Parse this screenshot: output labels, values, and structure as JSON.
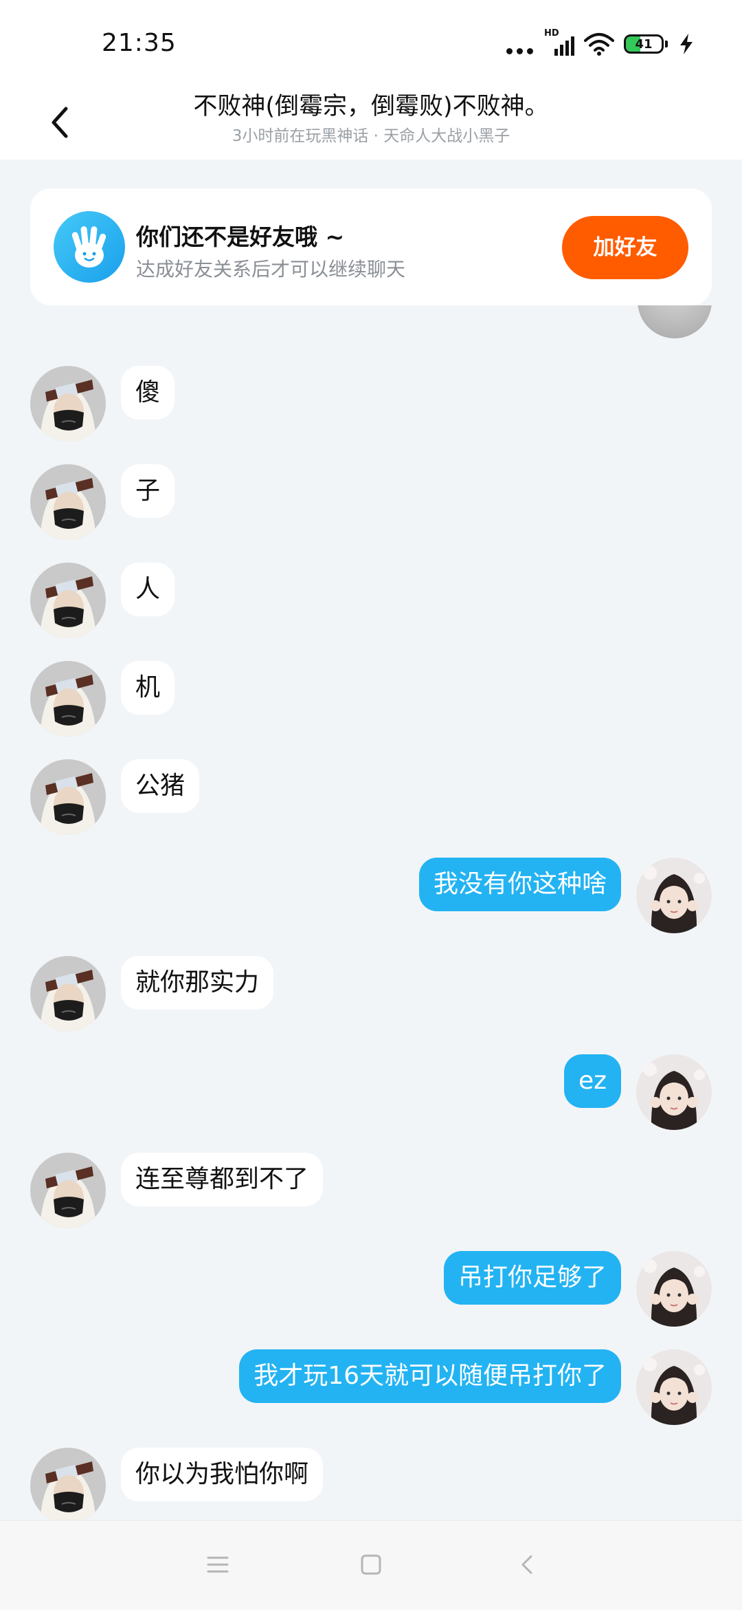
{
  "status_bar": {
    "time": "21:35",
    "network_label": "HD",
    "battery_level": 41,
    "battery_text": "41",
    "icons": [
      "more-dots-icon",
      "signal-icon",
      "wifi-icon",
      "battery-icon",
      "charging-icon"
    ]
  },
  "header": {
    "title": "不败神(倒霉宗，倒霉败)不败神。",
    "subtitle": "3小时前在玩黑神话 · 天命人大战小黑子",
    "back_icon": "chevron-left-icon"
  },
  "friend_card": {
    "icon": "waving-hand-icon",
    "title": "你们还不是好友哦 ~",
    "subtitle": "达成好友关系后才可以继续聊天",
    "button_label": "加好友",
    "button_color": "#ff5c00"
  },
  "colors": {
    "outgoing_bubble": "#23b3f2",
    "incoming_bubble": "#ffffff",
    "chat_background": "#f2f5f8"
  },
  "messages": [
    {
      "side": "left",
      "text": "傻"
    },
    {
      "side": "left",
      "text": "子"
    },
    {
      "side": "left",
      "text": "人"
    },
    {
      "side": "left",
      "text": "机"
    },
    {
      "side": "left",
      "text": "公猪"
    },
    {
      "side": "right",
      "text": "我没有你这种啥"
    },
    {
      "side": "left",
      "text": "就你那实力"
    },
    {
      "side": "right",
      "text": "ez"
    },
    {
      "side": "left",
      "text": "连至尊都到不了"
    },
    {
      "side": "right",
      "text": "吊打你足够了"
    },
    {
      "side": "right",
      "text": "我才玩16天就可以随便吊打你了"
    },
    {
      "side": "left",
      "text": "你以为我怕你啊"
    }
  ],
  "nav_bar": {
    "icons": [
      "menu-icon",
      "home-square-icon",
      "back-triangle-icon"
    ]
  }
}
